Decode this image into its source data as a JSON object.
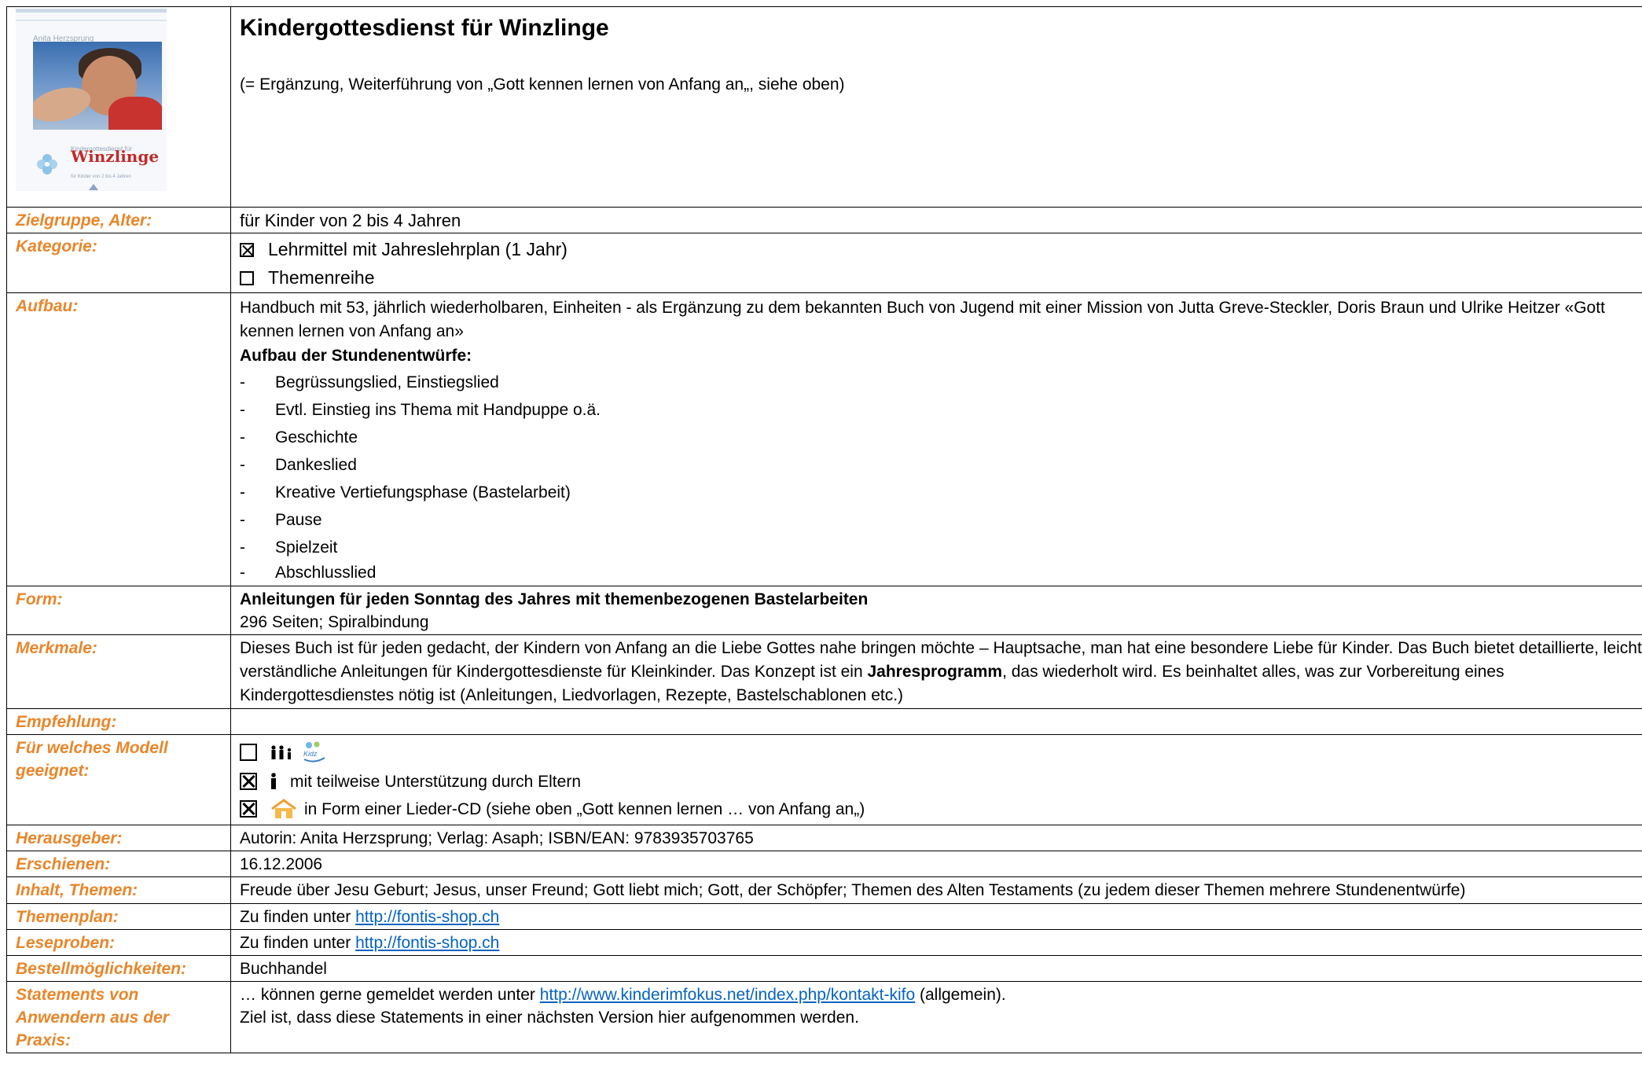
{
  "header": {
    "cover_image": {
      "author": "Anita Herzsprung",
      "subtitle": "Kindergottesdienst für",
      "title": "Winzlinge",
      "fine": "für Kinder von 2 bis 4 Jahren"
    },
    "title": "Kindergottesdienst für Winzlinge",
    "subtitle": "(= Ergänzung, Weiterführung von „Gott kennen lernen von Anfang an„, siehe oben)"
  },
  "colors": {
    "label": "#e8862a",
    "link": "#0563c1",
    "border": "#000000"
  },
  "rows": {
    "zielgruppe": {
      "label": "Zielgruppe, Alter:",
      "value": "für Kinder von 2 bis 4 Jahren"
    },
    "kategorie": {
      "label": "Kategorie:",
      "options": [
        {
          "label": "Lehrmittel mit Jahreslehrplan (1 Jahr)",
          "checked": true
        },
        {
          "label": "Themenreihe",
          "checked": false
        }
      ]
    },
    "aufbau": {
      "label": "Aufbau:",
      "intro": "Handbuch mit 53, jährlich wiederholbaren, Einheiten - als Ergänzung zu dem bekannten Buch von Jugend mit einer Mission von Jutta Greve-Steckler, Doris Braun und Ulrike Heitzer «Gott kennen lernen von Anfang an»",
      "heading": "Aufbau der Stundenentwürfe:",
      "steps": [
        "Begrüssungslied, Einstiegslied",
        "Evtl. Einstieg ins Thema mit Handpuppe o.ä.",
        "Geschichte",
        "Dankeslied",
        "Kreative Vertiefungsphase (Bastelarbeit)",
        "Pause",
        "Spielzeit",
        "Abschlusslied"
      ]
    },
    "form": {
      "label": "Form:",
      "bold": "Anleitungen für jeden Sonntag des Jahres mit themenbezogenen Bastelarbeiten",
      "detail": "296 Seiten; Spiralbindung"
    },
    "merkmale": {
      "label": "Merkmale:",
      "text_before": "Dieses Buch ist für jeden gedacht, der Kindern von Anfang an die Liebe Gottes nahe bringen möchte – Hauptsache, man hat eine besondere Liebe für Kinder. Das Buch bietet detaillierte, leicht verständliche Anleitungen für Kindergottesdienste für Kleinkinder. Das Konzept ist ein ",
      "text_bold": "Jahresprogramm",
      "text_after": ", das wiederholt wird. Es beinhaltet alles, was zur Vorbereitung eines Kindergottesdienstes nötig ist (Anleitungen, Liedvorlagen, Rezepte, Bastelschablonen etc.)"
    },
    "empfehlung": {
      "label": "Empfehlung:",
      "value": ""
    },
    "modell": {
      "label": "Für welches Modell geeignet:",
      "options": [
        {
          "checked": false,
          "icons": [
            "family-icon",
            "kidz-logo-icon"
          ],
          "text": ""
        },
        {
          "checked": true,
          "icons": [
            "person-icon"
          ],
          "text": "mit teilweise Unterstützung durch Eltern"
        },
        {
          "checked": true,
          "icons": [
            "home-icon"
          ],
          "text": "in Form einer Lieder-CD (siehe oben „Gott kennen lernen … von Anfang an„)"
        }
      ]
    },
    "herausgeber": {
      "label": "Herausgeber:",
      "value": "Autorin: Anita Herzsprung; Verlag: Asaph; ISBN/EAN: 9783935703765"
    },
    "erschienen": {
      "label": "Erschienen:",
      "value": "16.12.2006"
    },
    "inhalt": {
      "label": "Inhalt, Themen:",
      "value": "Freude über Jesu Geburt; Jesus, unser Freund; Gott liebt mich; Gott, der Schöpfer; Themen des Alten Testaments (zu jedem dieser Themen mehrere Stundenentwürfe)"
    },
    "themenplan": {
      "label": "Themenplan:",
      "prefix": "Zu finden unter ",
      "link": "http://fontis-shop.ch"
    },
    "leseproben": {
      "label": "Leseproben:",
      "prefix": "Zu finden unter ",
      "link": "http://fontis-shop.ch"
    },
    "bestell": {
      "label": "Bestellmöglichkeiten:",
      "value": "Buchhandel"
    },
    "statements": {
      "label": "Statements von Anwendern aus der Praxis:",
      "prefix": "… können gerne gemeldet werden unter ",
      "link": "http://www.kinderimfokus.net/index.php/kontakt-kifo",
      "suffix": " (allgemein).",
      "line2": "Ziel ist, dass diese Statements in einer nächsten Version hier aufgenommen werden."
    }
  }
}
